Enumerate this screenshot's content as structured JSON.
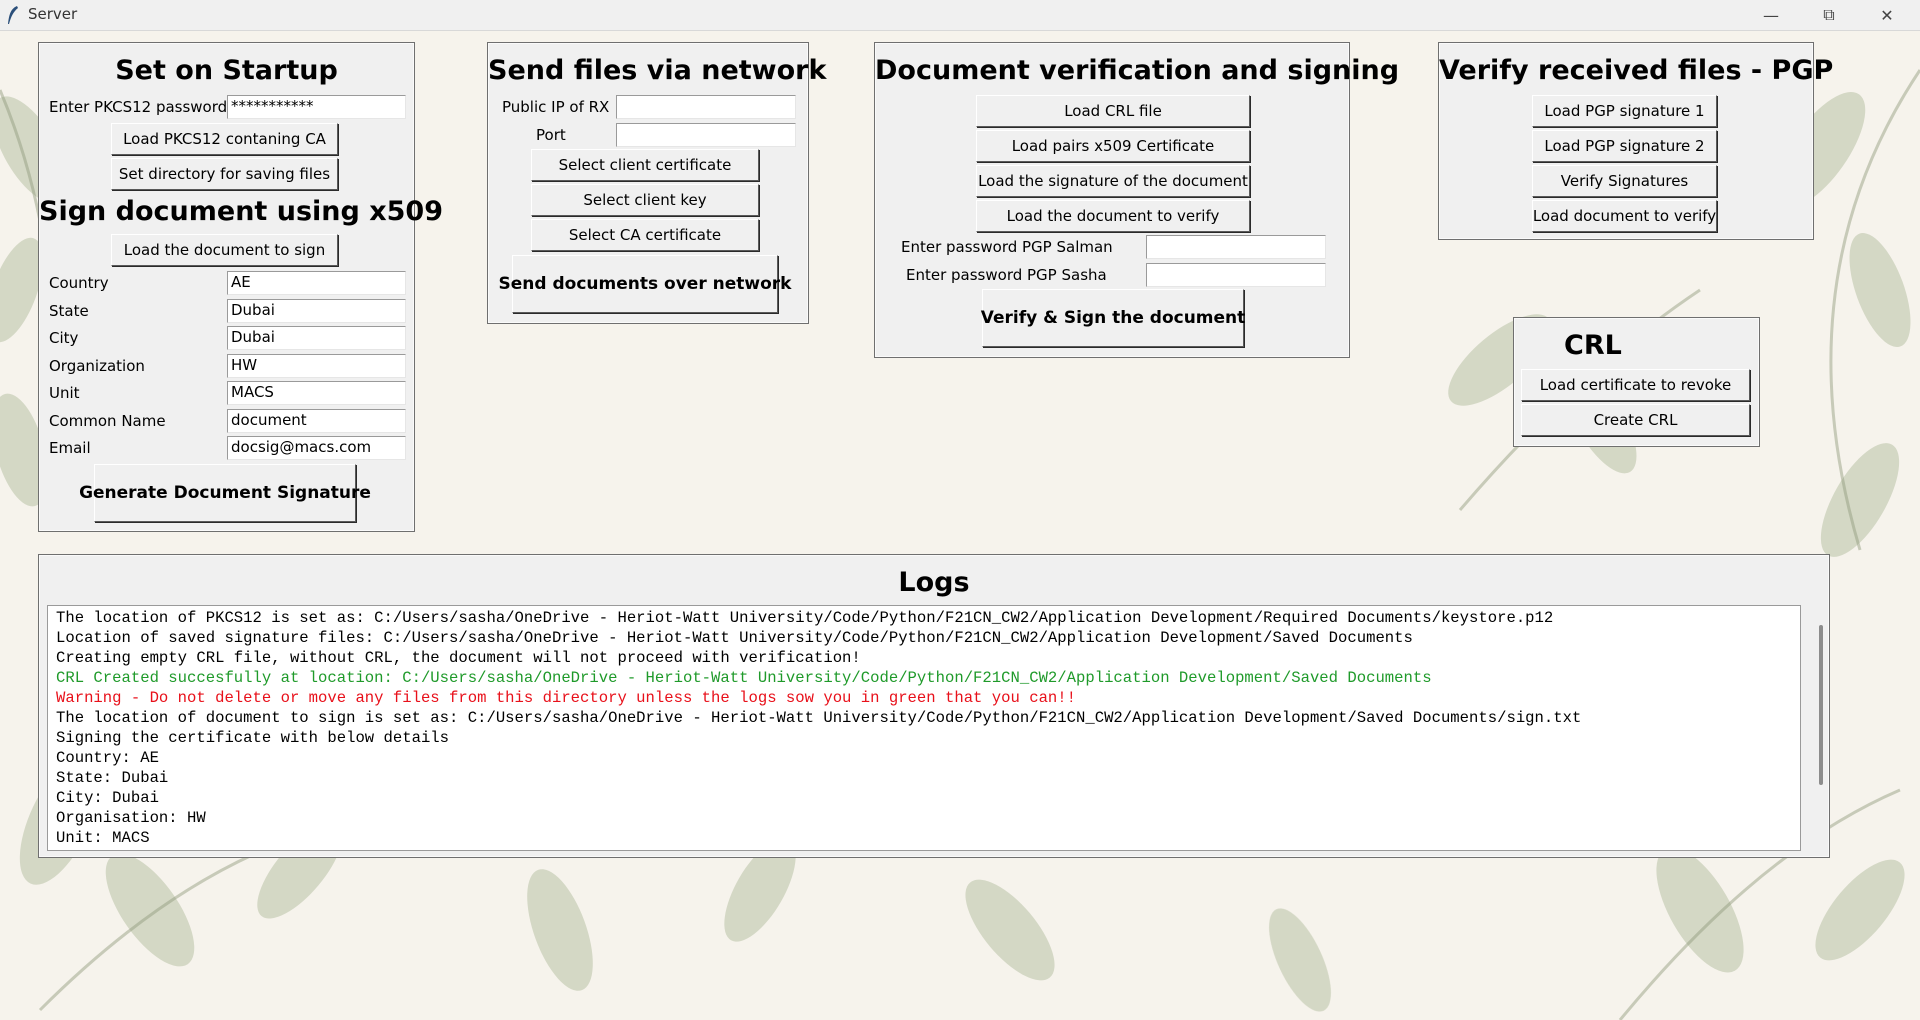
{
  "window": {
    "title": "Server"
  },
  "startup": {
    "title": "Set on Startup",
    "pkcs_label": "Enter PKCS12 password",
    "pkcs_value": "***********",
    "load_pkcs_btn": "Load PKCS12 contaning CA",
    "set_dir_btn": "Set directory for saving files"
  },
  "sign": {
    "title": "Sign document using x509",
    "load_doc_btn": "Load the document to sign",
    "fields": [
      {
        "label": "Country",
        "value": "AE"
      },
      {
        "label": "State",
        "value": "Dubai"
      },
      {
        "label": "City",
        "value": "Dubai"
      },
      {
        "label": "Organization",
        "value": "HW"
      },
      {
        "label": "Unit",
        "value": "MACS"
      },
      {
        "label": "Common Name",
        "value": "document"
      },
      {
        "label": "Email",
        "value": "docsig@macs.com"
      }
    ],
    "generate_btn": "Generate Document Signature"
  },
  "network": {
    "title": "Send files via network",
    "ip_label": "Public IP of RX",
    "ip_value": "",
    "port_label": "Port",
    "port_value": "",
    "client_cert_btn": "Select client certificate",
    "client_key_btn": "Select client key",
    "ca_cert_btn": "Select CA certificate",
    "send_btn": "Send documents over network"
  },
  "verify": {
    "title": "Document verification and signing",
    "load_crl_btn": "Load CRL file",
    "load_pairs_btn": "Load pairs x509 Certificate",
    "load_sig_btn": "Load the signature of the document",
    "load_doc_btn": "Load the document to verify",
    "pgp_salman_label": "Enter password PGP Salman",
    "pgp_salman_value": "",
    "pgp_sasha_label": "Enter password PGP Sasha",
    "pgp_sasha_value": "",
    "verify_sign_btn": "Verify & Sign the document"
  },
  "pgp": {
    "title": "Verify received files - PGP",
    "sig1_btn": "Load PGP signature 1",
    "sig2_btn": "Load PGP signature 2",
    "verify_btn": "Verify Signatures",
    "load_doc_btn": "Load document to verify"
  },
  "crl": {
    "title": "CRL",
    "revoke_btn": "Load certificate to revoke",
    "create_btn": "Create CRL"
  },
  "logs": {
    "title": "Logs",
    "lines": [
      {
        "text": "The location of PKCS12 is set as: C:/Users/sasha/OneDrive - Heriot-Watt University/Code/Python/F21CN_CW2/Application Development/Required Documents/keystore.p12",
        "color": "#000000"
      },
      {
        "text": "Location of saved signature files: C:/Users/sasha/OneDrive - Heriot-Watt University/Code/Python/F21CN_CW2/Application Development/Saved Documents",
        "color": "#000000"
      },
      {
        "text": "Creating empty CRL file, without CRL, the document will not proceed with verification!",
        "color": "#000000"
      },
      {
        "text": "CRL Created succesfully at location: C:/Users/sasha/OneDrive - Heriot-Watt University/Code/Python/F21CN_CW2/Application Development/Saved Documents",
        "color": "#1f9a2a"
      },
      {
        "text": "Warning - Do not delete or move any files from this directory unless the logs sow you in green that you can!!",
        "color": "#e8101a"
      },
      {
        "text": "The location of document to sign is set as: C:/Users/sasha/OneDrive - Heriot-Watt University/Code/Python/F21CN_CW2/Application Development/Saved Documents/sign.txt",
        "color": "#000000"
      },
      {
        "text": "Signing the certificate with below details",
        "color": "#000000"
      },
      {
        "text": "Country: AE",
        "color": "#000000"
      },
      {
        "text": "State: Dubai",
        "color": "#000000"
      },
      {
        "text": "City: Dubai",
        "color": "#000000"
      },
      {
        "text": "Organisation: HW",
        "color": "#000000"
      },
      {
        "text": "Unit: MACS",
        "color": "#000000"
      }
    ]
  },
  "icons": [
    "feather-icon",
    "minimize-icon",
    "restore-icon",
    "close-icon"
  ]
}
